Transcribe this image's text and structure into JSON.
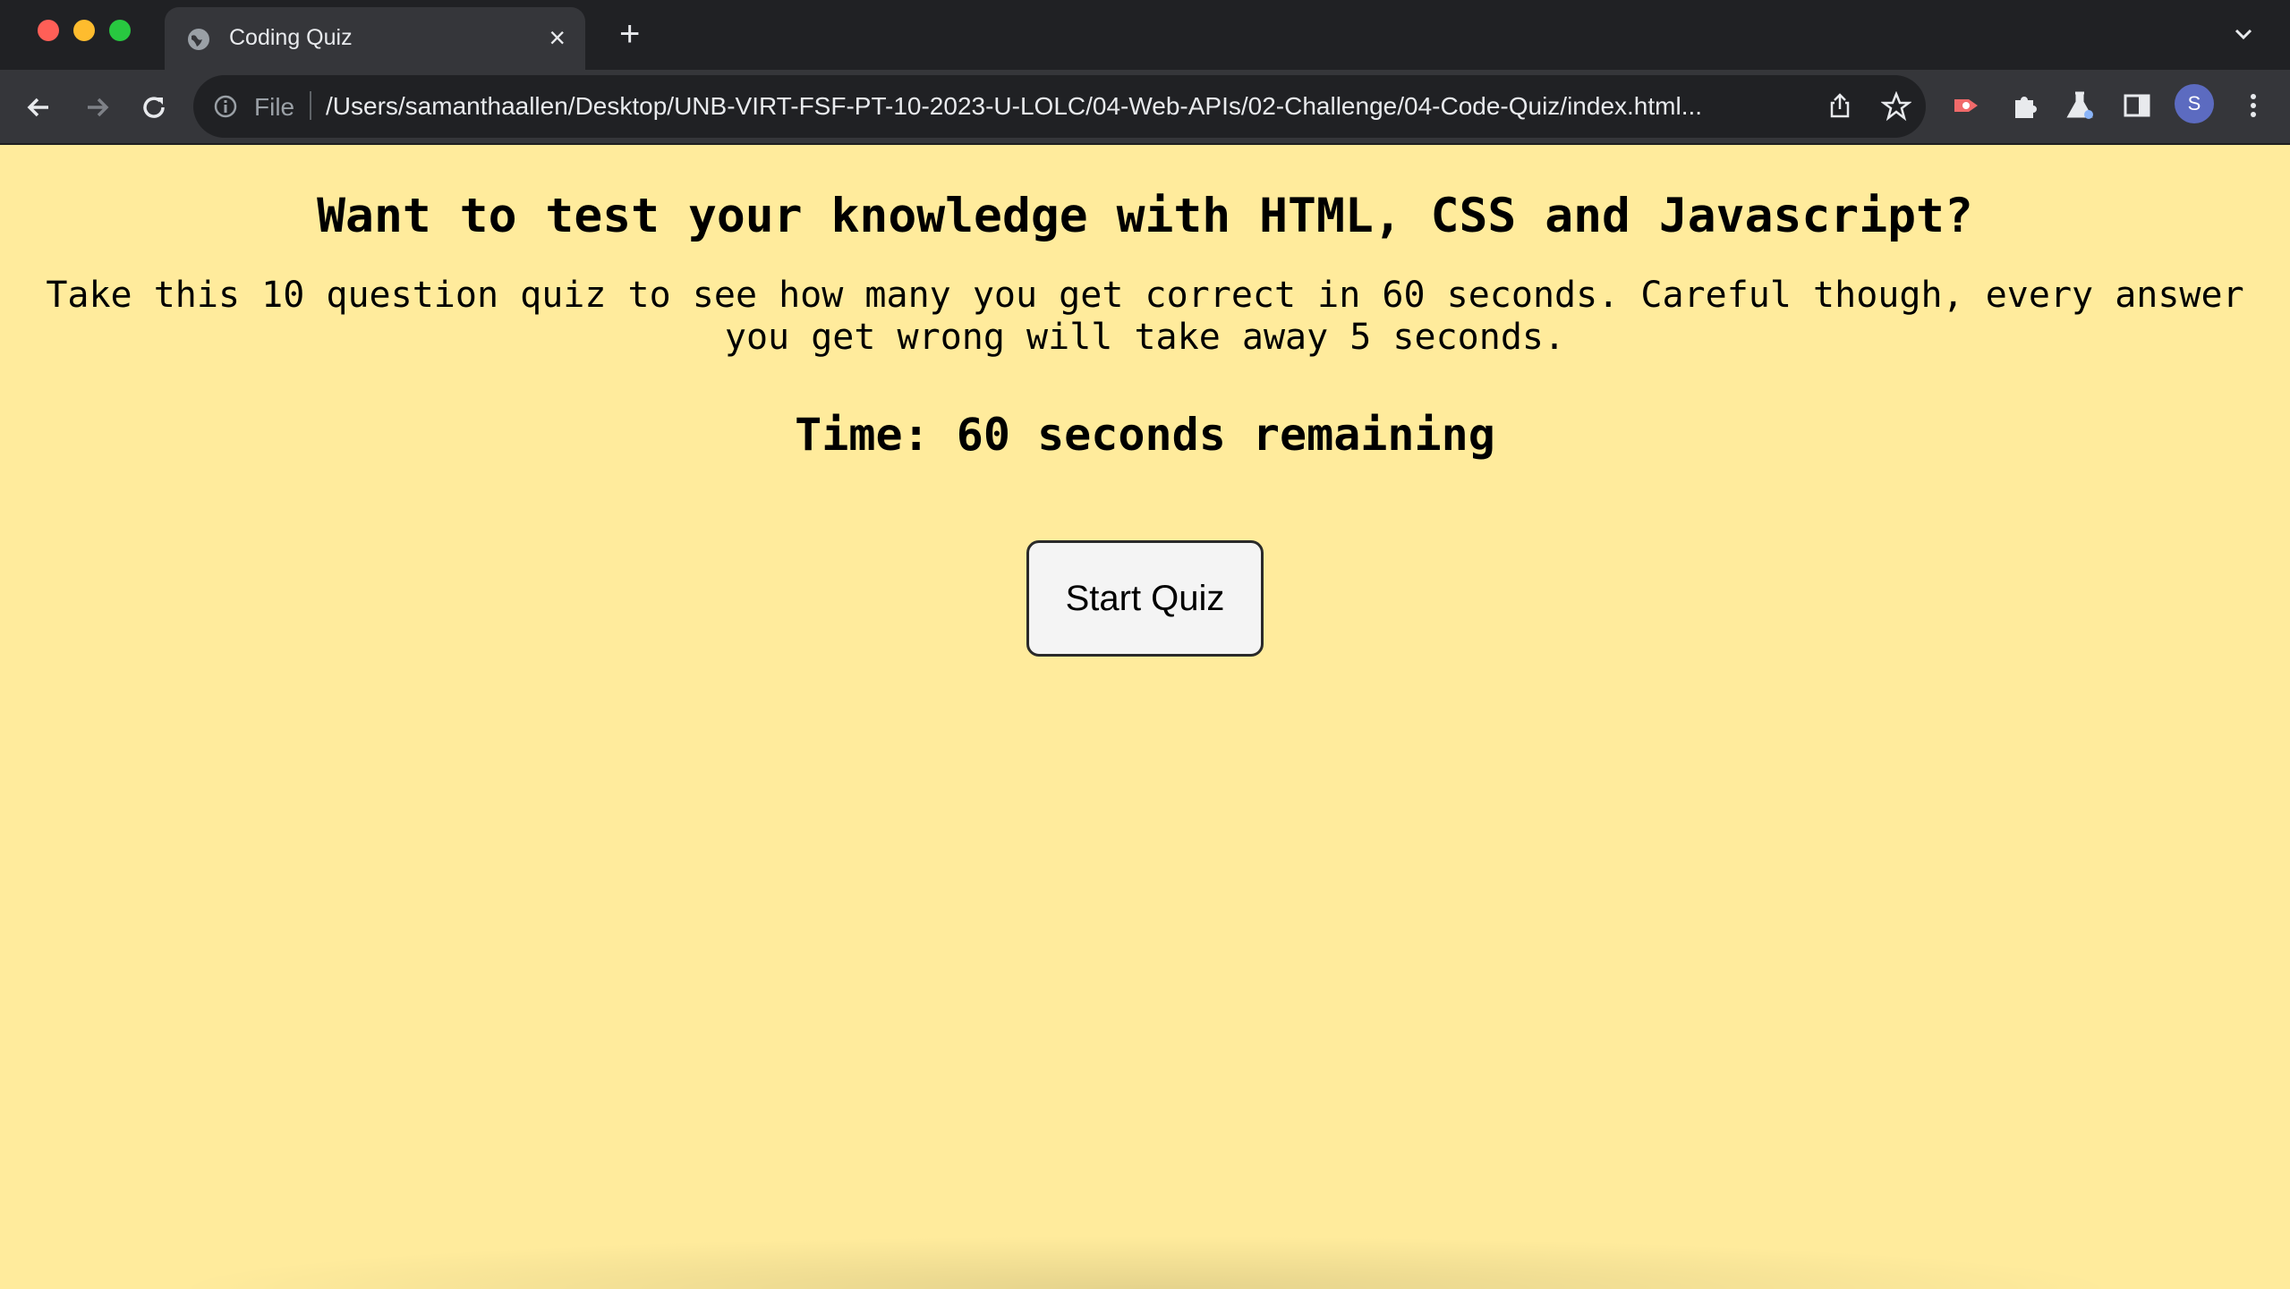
{
  "browser": {
    "tab": {
      "title": "Coding Quiz",
      "close_label": "×"
    },
    "new_tab_label": "+",
    "omnibox": {
      "scheme_label": "File",
      "url": "/Users/samanthaallen/Desktop/UNB-VIRT-FSF-PT-10-2023-U-LOLC/04-Web-APIs/02-Challenge/04-Code-Quiz/index.html..."
    },
    "profile_initial": "S",
    "icons": [
      "back-icon",
      "forward-icon",
      "reload-icon",
      "info-icon",
      "share-icon",
      "star-icon",
      "extension-record-icon",
      "puzzle-icon",
      "labs-icon",
      "side-panel-icon",
      "more-icon"
    ]
  },
  "page": {
    "heading": "Want to test your knowledge with HTML, CSS and Javascript?",
    "intro": "Take this 10 question quiz to see how many you get correct in 60 seconds. Careful though, every answer you get wrong will take away 5 seconds.",
    "timer": "Time: 60 seconds remaining",
    "start_button": "Start Quiz"
  },
  "colors": {
    "page_background": "#ffeb9c",
    "tabbar": "#202124",
    "toolbar": "#35363a",
    "button_background": "#f4f4f4"
  }
}
